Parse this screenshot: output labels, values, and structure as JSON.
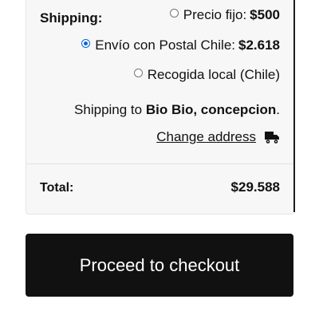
{
  "shipping": {
    "label": "Shipping:",
    "options": [
      {
        "name": "Precio fijo:",
        "price": "$500",
        "selected": false
      },
      {
        "name": "Envío con Postal Chile:",
        "price": "$2.618",
        "selected": true
      },
      {
        "name": "Recogida local (Chile)",
        "price": "",
        "selected": false
      }
    ],
    "destination_prefix": "Shipping to",
    "destination": "Bio Bio, concepcion",
    "destination_suffix": ".",
    "change_address_label": "Change address",
    "change_address_icon": "truck-icon"
  },
  "totals": {
    "label": "Total:",
    "value": "$29.588"
  },
  "checkout_button": {
    "label": "Proceed to checkout"
  },
  "colors": {
    "panel_bg": "#f7f7f7",
    "button_bg": "#111111",
    "radio_selected": "#0a66d8"
  }
}
